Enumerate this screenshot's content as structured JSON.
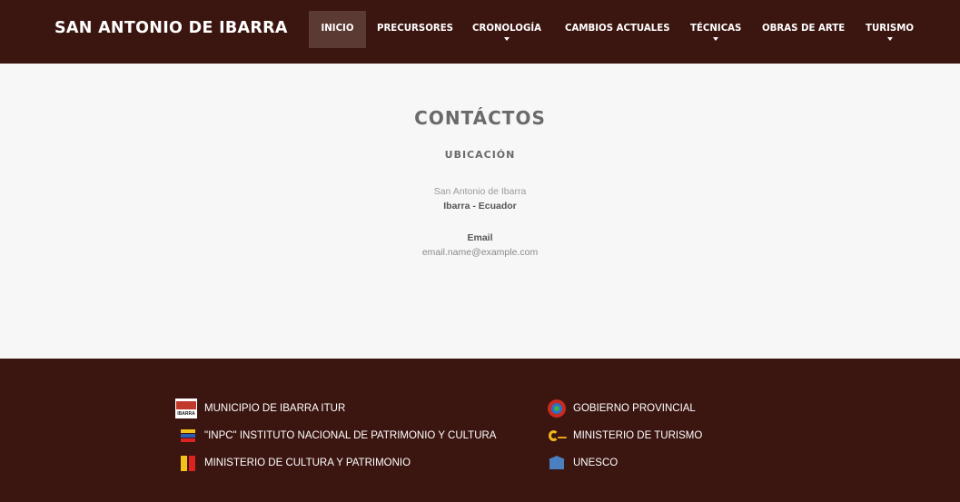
{
  "header": {
    "brand": "SAN ANTONIO DE IBARRA",
    "nav": [
      {
        "label": "INICIO",
        "active": true,
        "has_dropdown": false
      },
      {
        "label": "PRECURSORES",
        "active": false,
        "has_dropdown": false
      },
      {
        "label": "CRONOLOGÍA",
        "active": false,
        "has_dropdown": true
      },
      {
        "label": "CAMBIOS ACTUALES",
        "active": false,
        "has_dropdown": false
      },
      {
        "label": "TÉCNICAS",
        "active": false,
        "has_dropdown": true
      },
      {
        "label": "OBRAS DE ARTE",
        "active": false,
        "has_dropdown": false
      },
      {
        "label": "TURISMO",
        "active": false,
        "has_dropdown": true
      }
    ]
  },
  "contact": {
    "title": "CONTÁCTOS",
    "subtitle": "UBICACIÓN",
    "address_line1": "San Antonio de Ibarra",
    "address_line2": "Ibarra - Ecuador",
    "email_label": "Email",
    "email_value": "email.name@example.com"
  },
  "footer": {
    "links": [
      {
        "label": "MUNICIPIO DE IBARRA ITUR",
        "icon": "ibarra-logo-icon"
      },
      {
        "label": "\"INPC\" INSTITUTO NACIONAL DE PATRIMONIO Y CULTURA",
        "icon": "inpc-logo-icon"
      },
      {
        "label": "MINISTERIO DE CULTURA Y PATRIMONIO",
        "icon": "cultura-logo-icon"
      },
      {
        "label": "GOBIERNO PROVINCIAL",
        "icon": "gobierno-logo-icon"
      },
      {
        "label": "MINISTERIO DE TURISMO",
        "icon": "turismo-logo-icon"
      },
      {
        "label": "UNESCO",
        "icon": "unesco-logo-icon"
      }
    ],
    "ibarra_logo_text": "IBARRA"
  },
  "colors": {
    "header_bg": "#3b1510",
    "active_nav_bg": "#5b3a34",
    "page_bg": "#f7f7f7",
    "footer_bg": "#3b1510"
  }
}
